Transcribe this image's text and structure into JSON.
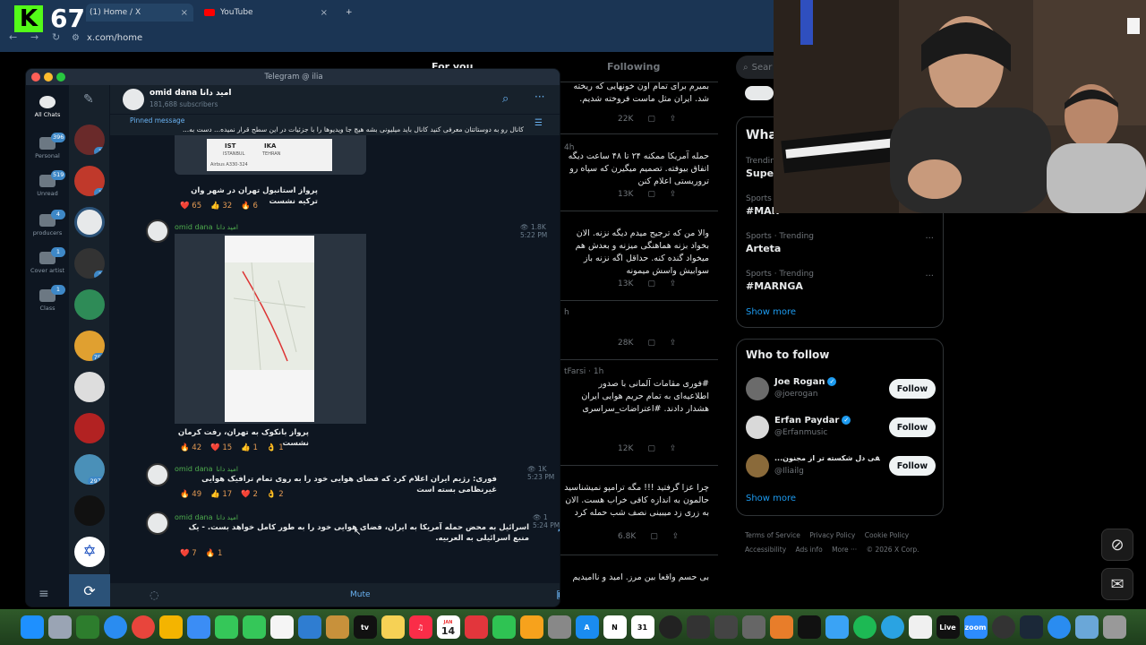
{
  "browser": {
    "stream_count": "67",
    "tabs": [
      {
        "label": "(1) Home / X",
        "close": "×"
      },
      {
        "label": "YouTube",
        "close": "×"
      }
    ],
    "new_tab": "+",
    "url": "x.com/home"
  },
  "x": {
    "tab_foryou": "For you",
    "tab_following": "Following",
    "search_placeholder": "Sear",
    "posts": [
      {
        "text": "بمیرم برای تمام اون خونهایی که ریخته شد. ایران مثل ماست فروخته شدیم.",
        "time": "",
        "views": "22K"
      },
      {
        "text": "حمله آمریکا ممکنه ۲۴ تا ۴۸ ساعت دیگه اتفاق بیوفته. تصمیم میگیرن که سپاه رو تروریستی اعلام کنن",
        "time": "4h",
        "views": "13K"
      },
      {
        "text": "والا من که ترجیح میدم دیگه نزنه. الان بخواد بزنه هماهنگی میزنه و بعدش هم میخواد گنده کنه. حداقل اگه نزنه باز سوابیش واسش میمونه",
        "time": "",
        "views": "13K"
      },
      {
        "text": "",
        "time": "h",
        "views": "28K"
      },
      {
        "text": "#فوری مقامات آلمانی با صدور اطلاعیه‌ای به تمام حریم هوایی ایران هشدار دادند. #اعتراضات_سراسری",
        "time": "tFarsi · 1h",
        "views": "12K"
      },
      {
        "text": "چرا عزا گرفتید !!! مگه ترامپو نمیشناسید حالمون به اندازه کافی خراب هست. الان به زری زد میبینی نصف شب حمله کرد",
        "time": "",
        "views": "6.8K"
      },
      {
        "text": "بی حسم واقعا بین مرز. امید و ناامیدیم",
        "time": "",
        "views": ""
      }
    ],
    "trends": [
      {
        "label": "Trendin",
        "name": "Super"
      },
      {
        "label": "Sports · Trending",
        "name": "#MAR"
      },
      {
        "label": "Sports · Trending",
        "name": "Arteta"
      },
      {
        "label": "Sports · Trending",
        "name": "#MARNGA"
      }
    ],
    "trends_heading": "What",
    "show_more": "Show more",
    "who_to_follow": "Who to follow",
    "follow_suggestions": [
      {
        "name": "Joe Rogan",
        "handle": "@joerogan",
        "button": "Follow"
      },
      {
        "name": "Erfan Paydar",
        "handle": "@Erfanmusic",
        "button": "Follow"
      },
      {
        "name": "...ر از بافقی دل شکسته تر از مجنون",
        "handle": "@Iliailg",
        "button": "Follow"
      }
    ],
    "footer": [
      "Terms of Service",
      "Privacy Policy",
      "Cookie Policy",
      "Accessibility",
      "Ads info",
      "More ···",
      "© 2026 X Corp."
    ]
  },
  "telegram": {
    "window_title": "Telegram @ ilia",
    "folders": [
      {
        "label": "All Chats",
        "badge": ""
      },
      {
        "label": "Personal",
        "badge": "396"
      },
      {
        "label": "Unread",
        "badge": "519"
      },
      {
        "label": "producers",
        "badge": "4"
      },
      {
        "label": "Cover artist",
        "badge": "1"
      },
      {
        "label": "Class",
        "badge": "1"
      }
    ],
    "chat_badges": [
      "1",
      "1",
      "",
      "2",
      "",
      "751",
      "",
      "",
      "2977",
      "",
      ""
    ],
    "channel": {
      "name": "omid dana",
      "name_fa": "امید دانا",
      "subscribers": "181,688 subscribers"
    },
    "pinned": {
      "label": "Pinned message",
      "text": "کانال رو به دوستاتتان معرفی کنید کانال باید میلیونی بشه هیچ جا ویدیوها را با جزئیات در این سطح قرار نمیده... دست به..."
    },
    "messages": [
      {
        "name": "omid dana",
        "name_fa": "امید دانا",
        "text": "پرواز استانبول تهران در شهر وان ترکیه نشست",
        "views": "",
        "time": "",
        "reactions": [
          "❤️ 65",
          "👍 32",
          "🔥 6"
        ]
      },
      {
        "name": "omid dana",
        "name_fa": "امید دانا",
        "text": "پرواز بانکوک به تهران، رفت کرمان نشست",
        "views": "👁 1.8K",
        "time": "5:22 PM",
        "reactions": [
          "🔥 42",
          "❤️ 15",
          "👍 1",
          "👌 1"
        ]
      },
      {
        "name": "omid dana",
        "name_fa": "امید دانا",
        "text": "فوری: رژیم ایران اعلام کرد که فضای هوایی خود را به روی تمام ترافیک هوایی غیرنظامی بسته است",
        "views": "👁 1K",
        "time": "5:23 PM",
        "reactions": [
          "🔥 49",
          "👍 17",
          "❤️ 2",
          "👌 2"
        ]
      },
      {
        "name": "omid dana",
        "name_fa": "امید دانا",
        "text": "اسرائیل به محض حمله آمریکا به ایران، فضای هوایی خود را به طور کامل خواهد بست. - یک منبع اسرائیلی به العربیه.",
        "views": "👁 1",
        "time": "5:24 PM",
        "reactions": [
          "❤️ 7",
          "🔥 1"
        ]
      }
    ],
    "mute_label": "Mute",
    "flight_card": {
      "from": "IST",
      "to": "IKA",
      "from_city": "ISTANBUL",
      "to_city": "TEHRAN",
      "aircraft": "Airbus A330-324"
    }
  },
  "dock": {
    "apps": [
      "Finder",
      "Launchpad",
      "Safari",
      "Chrome",
      "Photos",
      "Mail",
      "FaceTime",
      "Messages",
      "Freeform",
      "Notes",
      "TV",
      "Stickies",
      "Music",
      "Calendar",
      "Numbers",
      "Pages",
      "Xcode",
      "App Store",
      "Notion",
      "Fantastical",
      "Logic",
      "OBS",
      "Settings",
      "Final Cut",
      "Vectorize",
      "Preview",
      "Spotify",
      "Telegram",
      "Script",
      "Live",
      "Zoom",
      "Discord",
      "Steam",
      "Safari Beta",
      "Folder",
      "Trash"
    ],
    "calendar_day": "14",
    "calendar_month": "JAN"
  }
}
